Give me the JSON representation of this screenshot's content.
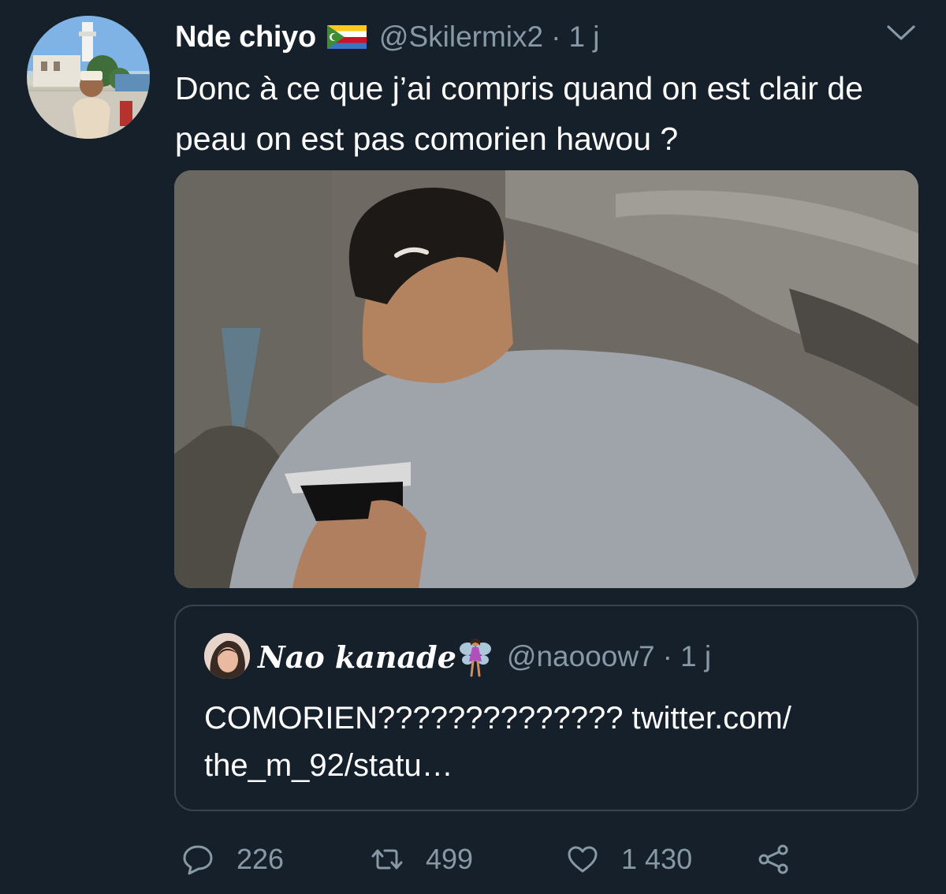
{
  "tweet": {
    "display_name": "Nde chiyo",
    "flag_icon": "comoros-flag-icon",
    "handle": "@Skilermix2",
    "separator": "·",
    "time": "1 j",
    "text": "Donc à ce que j’ai compris quand on est clair de peau on est pas comorien hawou ?",
    "menu_icon": "chevron-down-icon"
  },
  "quoted": {
    "display_name": "Nao kanade",
    "name_emoji_icon": "fairy-icon",
    "handle": "@naooow7",
    "separator": "·",
    "time": "1 j",
    "text": "COMORIEN?????????????? twitter.com/ the_m_92/statu…"
  },
  "actions": {
    "reply": {
      "icon": "reply-icon",
      "count": "226"
    },
    "retweet": {
      "icon": "retweet-icon",
      "count": "499"
    },
    "like": {
      "icon": "heart-icon",
      "count": "1 430"
    },
    "share": {
      "icon": "share-icon"
    }
  },
  "colors": {
    "background": "#15202b",
    "secondary_text": "#8899a6",
    "border": "#38444d"
  }
}
